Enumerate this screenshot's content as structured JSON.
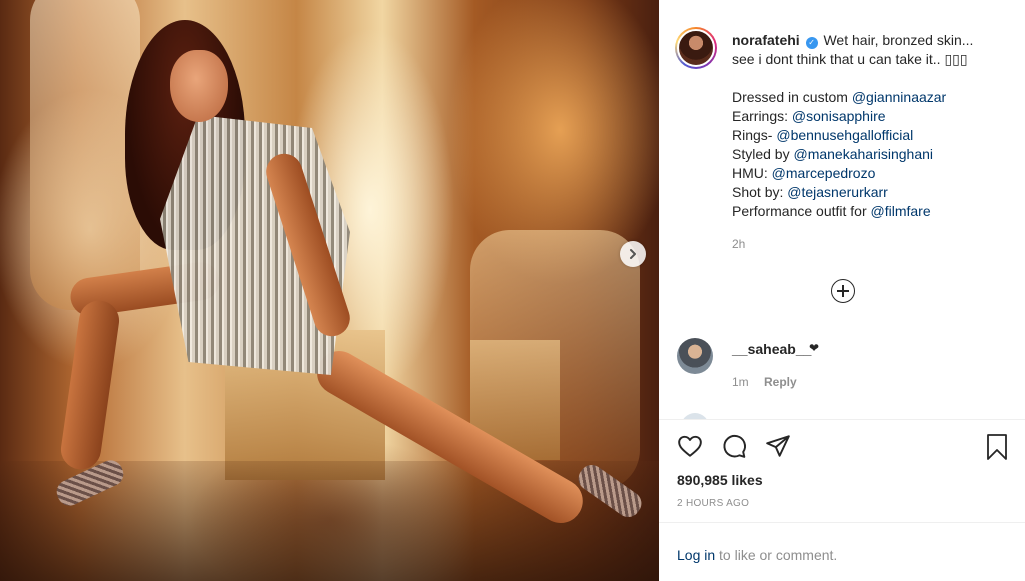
{
  "post": {
    "username": "norafatehi",
    "verified_mark": "✓",
    "caption_lines": [
      "Wet hair, bronzed skin...",
      "see i dont think that u can take it.. ▯▯▯"
    ],
    "credits": [
      {
        "prefix": "Dressed in custom ",
        "mention": "@gianninaazar"
      },
      {
        "prefix": "Earrings: ",
        "mention": "@sonisapphire"
      },
      {
        "prefix": "Rings- ",
        "mention": "@bennusehgallofficial"
      },
      {
        "prefix": "Styled by ",
        "mention": "@manekaharisinghani"
      },
      {
        "prefix": "HMU: ",
        "mention": "@marcepedrozo"
      },
      {
        "prefix": "Shot by: ",
        "mention": "@tejasnerurkarr"
      },
      {
        "prefix": "Performance outfit for ",
        "mention": "@filmfare"
      }
    ],
    "caption_time": "2h",
    "likes": "890,985 likes",
    "posted_ago": "2 HOURS AGO"
  },
  "comment": {
    "username": "__saheab__",
    "heart": "❤",
    "time": "1m",
    "reply_label": "Reply"
  },
  "login": {
    "link": "Log in",
    "rest": " to like or comment."
  },
  "icons": {
    "like": "heart-icon",
    "comment": "comment-icon",
    "share": "share-icon",
    "save": "bookmark-icon",
    "next": "chevron-right-icon",
    "more_comments": "plus-circle-icon"
  },
  "colors": {
    "text": "#262626",
    "muted": "#8e8e8e",
    "mention": "#00376b",
    "verified": "#3897f0"
  }
}
